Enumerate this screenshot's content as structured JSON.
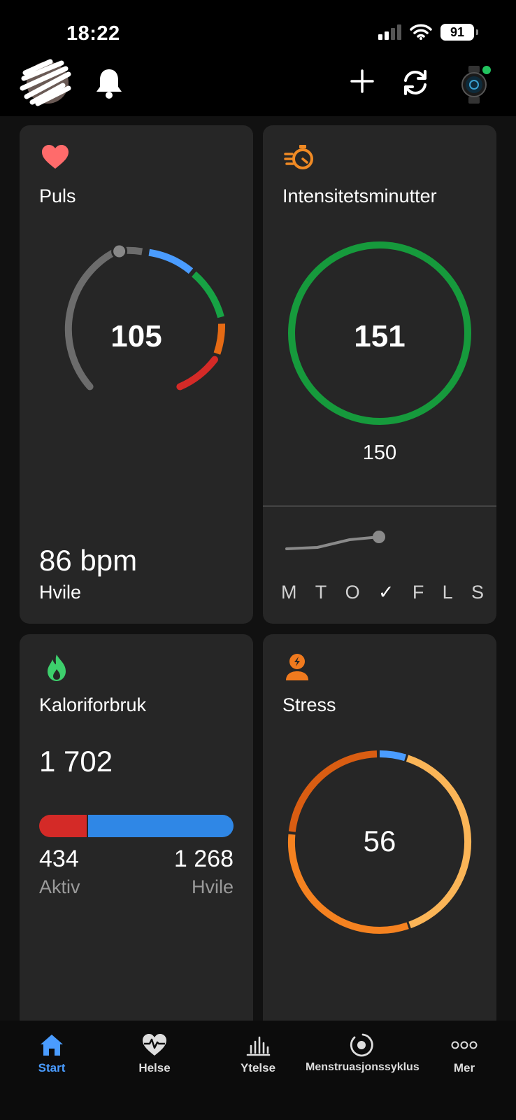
{
  "status_bar": {
    "time": "18:22",
    "battery": "91"
  },
  "cards": {
    "pulse": {
      "title": "Puls",
      "value": "105",
      "resting_value": "86 bpm",
      "resting_label": "Hvile"
    },
    "intensity": {
      "title": "Intensitetsminutter",
      "value": "151",
      "goal": "150",
      "days": [
        "M",
        "T",
        "O",
        "✓",
        "F",
        "L",
        "S"
      ]
    },
    "calories": {
      "title": "Kaloriforbruk",
      "total": "1 702",
      "active_value": "434",
      "active_label": "Aktiv",
      "rest_value": "1 268",
      "rest_label": "Hvile"
    },
    "stress": {
      "title": "Stress",
      "value": "56"
    }
  },
  "tabs": [
    {
      "label": "Start",
      "active": true,
      "icon": "home-icon"
    },
    {
      "label": "Helse",
      "active": false,
      "icon": "heart-pulse-icon"
    },
    {
      "label": "Ytelse",
      "active": false,
      "icon": "bar-chart-icon"
    },
    {
      "label": "Menstruasjonssyklus",
      "active": false,
      "icon": "cycle-icon"
    },
    {
      "label": "Mer",
      "active": false,
      "icon": "more-icon"
    }
  ],
  "colors": {
    "accent": "#4a9cff",
    "heart": "#ff6b6b",
    "intensity_ring": "#169a3c",
    "calorie_active": "#d42a27",
    "calorie_rest": "#2f87e6",
    "stress_low": "#4a9cff",
    "stress_mid": "#fbb557",
    "stress_high": "#e56a14"
  }
}
